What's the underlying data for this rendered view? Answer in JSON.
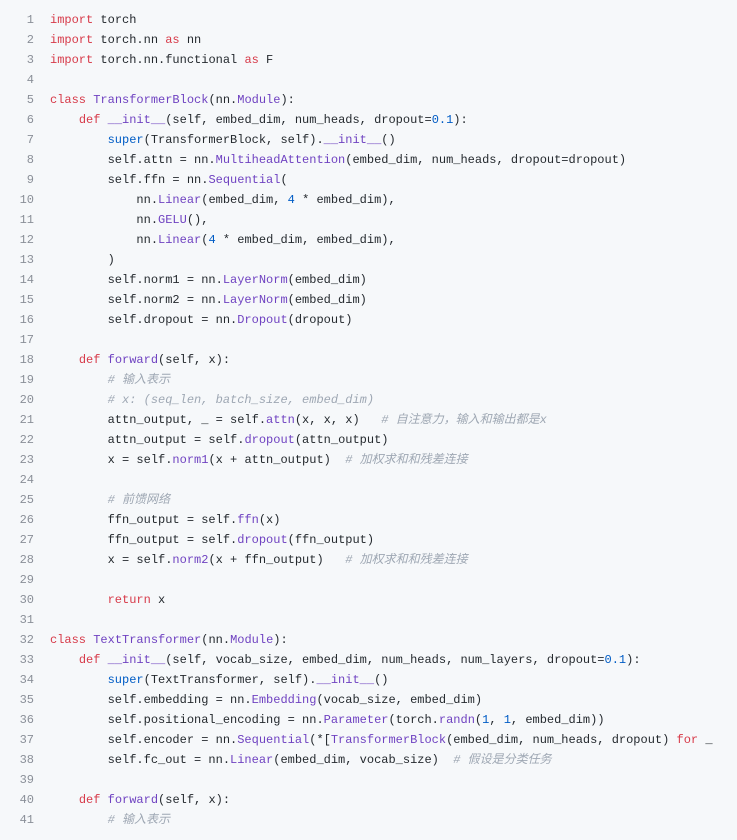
{
  "language": "python",
  "code_lines": [
    {
      "n": 1,
      "tokens": [
        [
          "kw",
          "import"
        ],
        [
          "nn",
          " torch"
        ]
      ]
    },
    {
      "n": 2,
      "tokens": [
        [
          "kw",
          "import"
        ],
        [
          "nn",
          " torch.nn "
        ],
        [
          "kw",
          "as"
        ],
        [
          "nn",
          " nn"
        ]
      ]
    },
    {
      "n": 3,
      "tokens": [
        [
          "kw",
          "import"
        ],
        [
          "nn",
          " torch.nn.functional "
        ],
        [
          "kw",
          "as"
        ],
        [
          "nn",
          " F"
        ]
      ]
    },
    {
      "n": 4,
      "tokens": [
        [
          "nn",
          ""
        ]
      ]
    },
    {
      "n": 5,
      "tokens": [
        [
          "kw",
          "class"
        ],
        [
          "nn",
          " "
        ],
        [
          "fn",
          "TransformerBlock"
        ],
        [
          "nn",
          "(nn."
        ],
        [
          "fn",
          "Module"
        ],
        [
          "nn",
          "):"
        ]
      ]
    },
    {
      "n": 6,
      "tokens": [
        [
          "nn",
          "    "
        ],
        [
          "kw",
          "def"
        ],
        [
          "nn",
          " "
        ],
        [
          "fn",
          "__init__"
        ],
        [
          "nn",
          "(self, embed_dim, num_heads, dropout="
        ],
        [
          "num",
          "0.1"
        ],
        [
          "nn",
          "):"
        ]
      ]
    },
    {
      "n": 7,
      "tokens": [
        [
          "nn",
          "        "
        ],
        [
          "builtin",
          "super"
        ],
        [
          "nn",
          "(TransformerBlock, self)."
        ],
        [
          "fn",
          "__init__"
        ],
        [
          "nn",
          "()"
        ]
      ]
    },
    {
      "n": 8,
      "tokens": [
        [
          "nn",
          "        self.attn = nn."
        ],
        [
          "fn",
          "MultiheadAttention"
        ],
        [
          "nn",
          "(embed_dim, num_heads, dropout=dropout)"
        ]
      ]
    },
    {
      "n": 9,
      "tokens": [
        [
          "nn",
          "        self.ffn = nn."
        ],
        [
          "fn",
          "Sequential"
        ],
        [
          "nn",
          "("
        ]
      ]
    },
    {
      "n": 10,
      "tokens": [
        [
          "nn",
          "            nn."
        ],
        [
          "fn",
          "Linear"
        ],
        [
          "nn",
          "(embed_dim, "
        ],
        [
          "num",
          "4"
        ],
        [
          "nn",
          " * embed_dim),"
        ]
      ]
    },
    {
      "n": 11,
      "tokens": [
        [
          "nn",
          "            nn."
        ],
        [
          "fn",
          "GELU"
        ],
        [
          "nn",
          "(),"
        ]
      ]
    },
    {
      "n": 12,
      "tokens": [
        [
          "nn",
          "            nn."
        ],
        [
          "fn",
          "Linear"
        ],
        [
          "nn",
          "("
        ],
        [
          "num",
          "4"
        ],
        [
          "nn",
          " * embed_dim, embed_dim),"
        ]
      ]
    },
    {
      "n": 13,
      "tokens": [
        [
          "nn",
          "        )"
        ]
      ]
    },
    {
      "n": 14,
      "tokens": [
        [
          "nn",
          "        self.norm1 = nn."
        ],
        [
          "fn",
          "LayerNorm"
        ],
        [
          "nn",
          "(embed_dim)"
        ]
      ]
    },
    {
      "n": 15,
      "tokens": [
        [
          "nn",
          "        self.norm2 = nn."
        ],
        [
          "fn",
          "LayerNorm"
        ],
        [
          "nn",
          "(embed_dim)"
        ]
      ]
    },
    {
      "n": 16,
      "tokens": [
        [
          "nn",
          "        self.dropout = nn."
        ],
        [
          "fn",
          "Dropout"
        ],
        [
          "nn",
          "(dropout)"
        ]
      ]
    },
    {
      "n": 17,
      "tokens": [
        [
          "nn",
          ""
        ]
      ]
    },
    {
      "n": 18,
      "tokens": [
        [
          "nn",
          "    "
        ],
        [
          "kw",
          "def"
        ],
        [
          "nn",
          " "
        ],
        [
          "fn",
          "forward"
        ],
        [
          "nn",
          "(self, x):"
        ]
      ]
    },
    {
      "n": 19,
      "tokens": [
        [
          "nn",
          "        "
        ],
        [
          "cmt",
          "# 输入表示"
        ]
      ]
    },
    {
      "n": 20,
      "tokens": [
        [
          "nn",
          "        "
        ],
        [
          "cmt",
          "# x: (seq_len, batch_size, embed_dim)"
        ]
      ]
    },
    {
      "n": 21,
      "tokens": [
        [
          "nn",
          "        attn_output, _ = self."
        ],
        [
          "fn",
          "attn"
        ],
        [
          "nn",
          "(x, x, x)   "
        ],
        [
          "cmt",
          "# 自注意力，输入和输出都是x"
        ]
      ]
    },
    {
      "n": 22,
      "tokens": [
        [
          "nn",
          "        attn_output = self."
        ],
        [
          "fn",
          "dropout"
        ],
        [
          "nn",
          "(attn_output)"
        ]
      ]
    },
    {
      "n": 23,
      "tokens": [
        [
          "nn",
          "        x = self."
        ],
        [
          "fn",
          "norm1"
        ],
        [
          "nn",
          "(x + attn_output)  "
        ],
        [
          "cmt",
          "# 加权求和和残差连接"
        ]
      ]
    },
    {
      "n": 24,
      "tokens": [
        [
          "nn",
          ""
        ]
      ]
    },
    {
      "n": 25,
      "tokens": [
        [
          "nn",
          "        "
        ],
        [
          "cmt",
          "# 前馈网络"
        ]
      ]
    },
    {
      "n": 26,
      "tokens": [
        [
          "nn",
          "        ffn_output = self."
        ],
        [
          "fn",
          "ffn"
        ],
        [
          "nn",
          "(x)"
        ]
      ]
    },
    {
      "n": 27,
      "tokens": [
        [
          "nn",
          "        ffn_output = self."
        ],
        [
          "fn",
          "dropout"
        ],
        [
          "nn",
          "(ffn_output)"
        ]
      ]
    },
    {
      "n": 28,
      "tokens": [
        [
          "nn",
          "        x = self."
        ],
        [
          "fn",
          "norm2"
        ],
        [
          "nn",
          "(x + ffn_output)   "
        ],
        [
          "cmt",
          "# 加权求和和残差连接"
        ]
      ]
    },
    {
      "n": 29,
      "tokens": [
        [
          "nn",
          ""
        ]
      ]
    },
    {
      "n": 30,
      "tokens": [
        [
          "nn",
          "        "
        ],
        [
          "kw",
          "return"
        ],
        [
          "nn",
          " x"
        ]
      ]
    },
    {
      "n": 31,
      "tokens": [
        [
          "nn",
          ""
        ]
      ]
    },
    {
      "n": 32,
      "tokens": [
        [
          "kw",
          "class"
        ],
        [
          "nn",
          " "
        ],
        [
          "fn",
          "TextTransformer"
        ],
        [
          "nn",
          "(nn."
        ],
        [
          "fn",
          "Module"
        ],
        [
          "nn",
          "):"
        ]
      ]
    },
    {
      "n": 33,
      "tokens": [
        [
          "nn",
          "    "
        ],
        [
          "kw",
          "def"
        ],
        [
          "nn",
          " "
        ],
        [
          "fn",
          "__init__"
        ],
        [
          "nn",
          "(self, vocab_size, embed_dim, num_heads, num_layers, dropout="
        ],
        [
          "num",
          "0.1"
        ],
        [
          "nn",
          "):"
        ]
      ]
    },
    {
      "n": 34,
      "tokens": [
        [
          "nn",
          "        "
        ],
        [
          "builtin",
          "super"
        ],
        [
          "nn",
          "(TextTransformer, self)."
        ],
        [
          "fn",
          "__init__"
        ],
        [
          "nn",
          "()"
        ]
      ]
    },
    {
      "n": 35,
      "tokens": [
        [
          "nn",
          "        self.embedding = nn."
        ],
        [
          "fn",
          "Embedding"
        ],
        [
          "nn",
          "(vocab_size, embed_dim)"
        ]
      ]
    },
    {
      "n": 36,
      "tokens": [
        [
          "nn",
          "        self.positional_encoding = nn."
        ],
        [
          "fn",
          "Parameter"
        ],
        [
          "nn",
          "(torch."
        ],
        [
          "fn",
          "randn"
        ],
        [
          "nn",
          "("
        ],
        [
          "num",
          "1"
        ],
        [
          "nn",
          ", "
        ],
        [
          "num",
          "1"
        ],
        [
          "nn",
          ", embed_dim))"
        ]
      ]
    },
    {
      "n": 37,
      "tokens": [
        [
          "nn",
          "        self.encoder = nn."
        ],
        [
          "fn",
          "Sequential"
        ],
        [
          "nn",
          "(*["
        ],
        [
          "fn",
          "TransformerBlock"
        ],
        [
          "nn",
          "(embed_dim, num_heads, dropout) "
        ],
        [
          "kw",
          "for"
        ],
        [
          "nn",
          " _"
        ]
      ]
    },
    {
      "n": 38,
      "tokens": [
        [
          "nn",
          "        self.fc_out = nn."
        ],
        [
          "fn",
          "Linear"
        ],
        [
          "nn",
          "(embed_dim, vocab_size)  "
        ],
        [
          "cmt",
          "# 假设是分类任务"
        ]
      ]
    },
    {
      "n": 39,
      "tokens": [
        [
          "nn",
          ""
        ]
      ]
    },
    {
      "n": 40,
      "tokens": [
        [
          "nn",
          "    "
        ],
        [
          "kw",
          "def"
        ],
        [
          "nn",
          " "
        ],
        [
          "fn",
          "forward"
        ],
        [
          "nn",
          "(self, x):"
        ]
      ]
    },
    {
      "n": 41,
      "tokens": [
        [
          "nn",
          "        "
        ],
        [
          "cmt",
          "# 输入表示"
        ]
      ]
    }
  ],
  "token_classes": {
    "kw": "tok-kw",
    "nn": "tok-nn",
    "fn": "tok-fn",
    "cls": "tok-cls",
    "num": "tok-num",
    "cmt": "tok-cmt",
    "builtin": "tok-builtin",
    "self": "tok-self",
    "op": "tok-op",
    "param": "tok-param"
  }
}
